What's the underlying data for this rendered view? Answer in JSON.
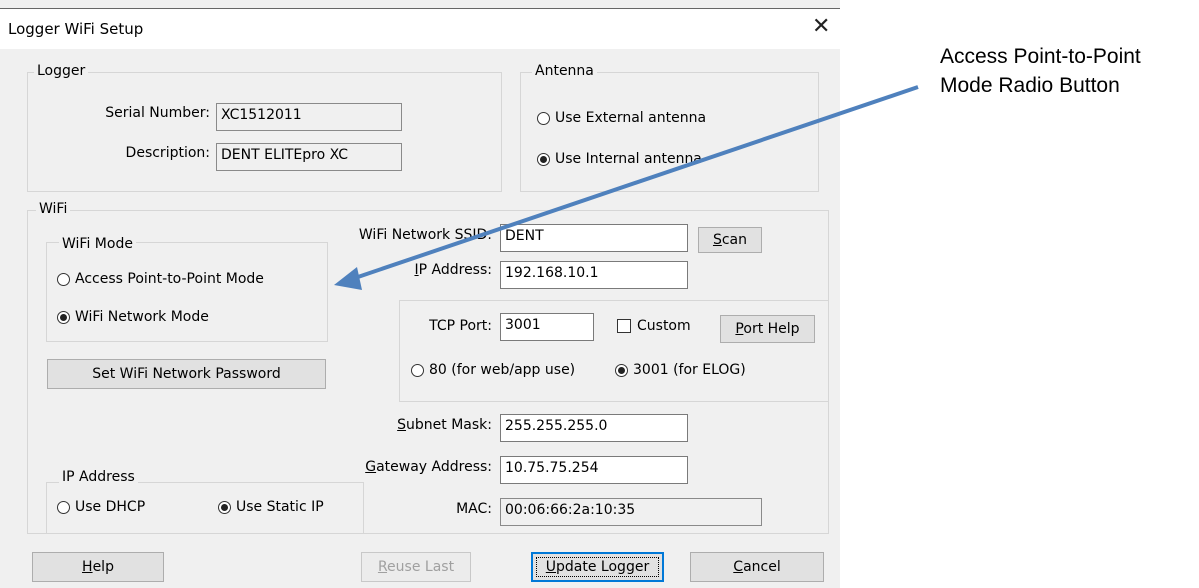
{
  "window": {
    "title": "Logger WiFi Setup",
    "close_label": "✕"
  },
  "logger": {
    "group_label": "Logger",
    "serial_label": "Serial Number:",
    "serial_value": "XC1512011",
    "description_label": "Description:",
    "description_value": "DENT ELITEpro XC"
  },
  "antenna": {
    "group_label": "Antenna",
    "external_label": "Use External antenna",
    "internal_label": "Use Internal antenna",
    "selected": "internal"
  },
  "wifi": {
    "group_label": "WiFi",
    "mode_group_label": "WiFi Mode",
    "ap_mode_label": "Access Point-to-Point Mode",
    "network_mode_label": "WiFi Network Mode",
    "mode_selected": "network",
    "set_password_label": "Set WiFi Network Password",
    "ssid_label": "WiFi Network SSID:",
    "ssid_value": "DENT",
    "scan_label_pre": "",
    "scan_label_u": "S",
    "scan_label_post": "can",
    "ip_label_u": "I",
    "ip_label_post": "P Address:",
    "ip_value": "192.168.10.1",
    "tcp_port_label": "TCP Port:",
    "tcp_port_value": "3001",
    "custom_label": "Custom",
    "port_help_u": "P",
    "port_help_post": "ort Help",
    "port80_label": "80 (for web/app use)",
    "port3001_label": "3001 (for ELOG)",
    "port_selected": "3001",
    "subnet_label_u": "S",
    "subnet_label_post": "ubnet Mask:",
    "subnet_value": "255.255.255.0",
    "gateway_label_u": "G",
    "gateway_label_post": "ateway Address:",
    "gateway_value": "10.75.75.254",
    "mac_label": "MAC:",
    "mac_value": "00:06:66:2a:10:35",
    "ip_group_label": "IP Address",
    "dhcp_label": "Use DHCP",
    "static_label": "Use Static IP",
    "ip_selected": "static"
  },
  "footer": {
    "help_u": "H",
    "help_post": "elp",
    "reuse_u": "R",
    "reuse_post": "euse Last",
    "update_u": "U",
    "update_post": "pdate Logger",
    "cancel_u": "C",
    "cancel_post": "ancel"
  },
  "annotation": {
    "line1": "Access Point-to-Point",
    "line2": "Mode Radio Button",
    "arrow_color": "#4f81bd"
  }
}
